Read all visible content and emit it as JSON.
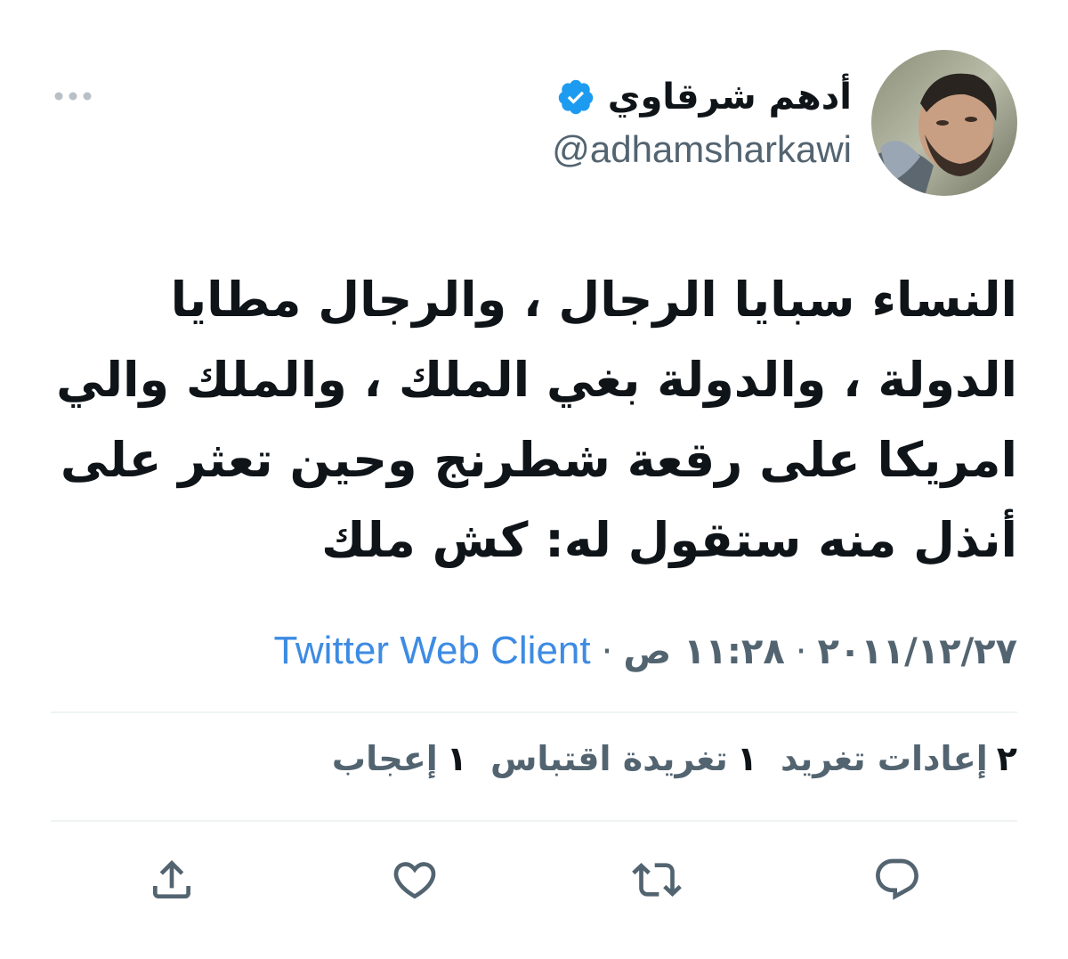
{
  "author": {
    "display_name": "أدهم شرقاوي",
    "handle": "@adhamsharkawi",
    "verified": true,
    "avatar_icon": "avatar-photo"
  },
  "tweet": {
    "text": "النساء سبايا الرجال ، والرجال مطايا\nالدولة ، والدولة بغي الملك ، والملك والي\nامريكا على رقعة شطرنج  وحين تعثر على\nأنذل منه ستقول له: كش ملك"
  },
  "meta": {
    "date": "٢٠١١/١٢/٢٧",
    "time": "١١:٢٨ ص",
    "separator": "·",
    "source": "Twitter Web Client"
  },
  "stats": {
    "retweets": {
      "count": "٢",
      "label": "إعادات تغريد"
    },
    "quotes": {
      "count": "١",
      "label": "تغريدة اقتباس"
    },
    "likes": {
      "count": "١",
      "label": "إعجاب"
    }
  },
  "actions": {
    "reply_icon": "reply-icon",
    "retweet_icon": "retweet-icon",
    "like_icon": "heart-icon",
    "share_icon": "share-icon"
  },
  "colors": {
    "text": "#0f1419",
    "secondary": "#536471",
    "link": "#3d8be3",
    "verified": "#1d9bf0",
    "divider": "#eff3f4"
  }
}
